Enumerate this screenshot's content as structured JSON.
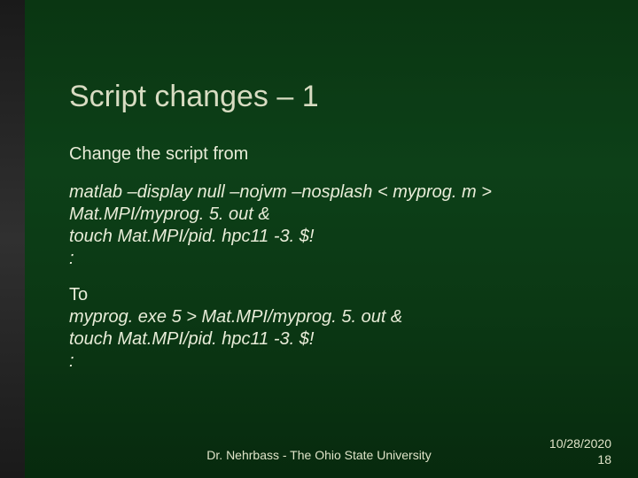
{
  "title": "Script changes – 1",
  "lead": "Change the script from",
  "block1": {
    "l1": " matlab –display null –nojvm –nosplash < myprog. m >",
    "l2": "Mat.MPI/myprog. 5. out &",
    "l3": "touch Mat.MPI/pid. hpc11 -3. $!",
    "l4": ":"
  },
  "block2": {
    "to": "To",
    "l1": "myprog. exe 5 > Mat.MPI/myprog. 5. out &",
    "l2": "touch Mat.MPI/pid. hpc11 -3. $!",
    "l3": ":"
  },
  "footer_center": "Dr. Nehrbass - The Ohio State University",
  "footer_date": "10/28/2020",
  "footer_page": "18"
}
